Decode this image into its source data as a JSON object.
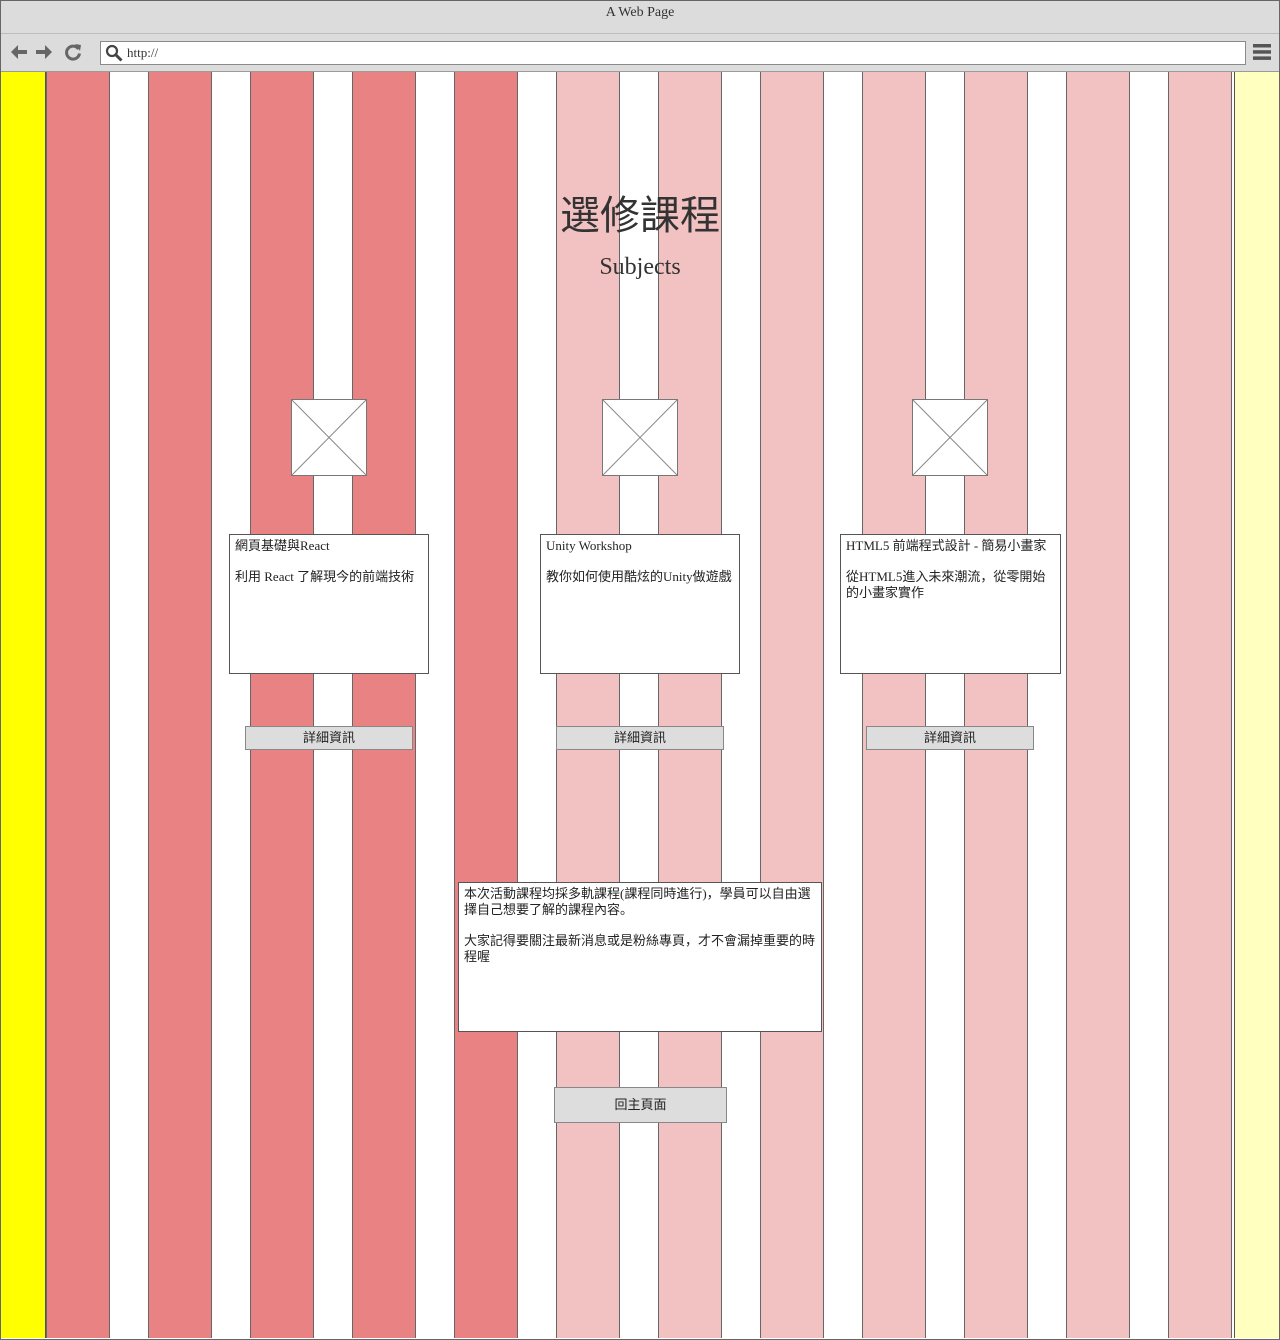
{
  "browser": {
    "window_title": "A Web Page",
    "url": "http://"
  },
  "page": {
    "title": "選修課程",
    "subtitle": "Subjects",
    "courses": [
      {
        "name": "網頁基礎與React",
        "description": "利用 React 了解現今的前端技術",
        "button_label": "詳細資訊"
      },
      {
        "name": "Unity Workshop",
        "description": "教你如何使用酷炫的Unity做遊戲",
        "button_label": "詳細資訊"
      },
      {
        "name": "HTML5 前端程式設計 - 簡易小畫家",
        "description": "從HTML5進入未來潮流，從零開始的小畫家實作",
        "button_label": "詳細資訊"
      }
    ],
    "notice": {
      "paragraph1": "本次活動課程均採多軌課程(課程同時進行)，學員可以自由選擇自己想要了解的課程內容。",
      "paragraph2": "大家記得要關注最新消息或是粉絲專頁，才不會漏掉重要的時程喔"
    },
    "home_button_label": "回主頁面"
  },
  "colors": {
    "margin_left": "#ffff00",
    "margin_right": "#ffffc0",
    "column_dark": "#e88283",
    "column_light": "#f2c1c1"
  }
}
